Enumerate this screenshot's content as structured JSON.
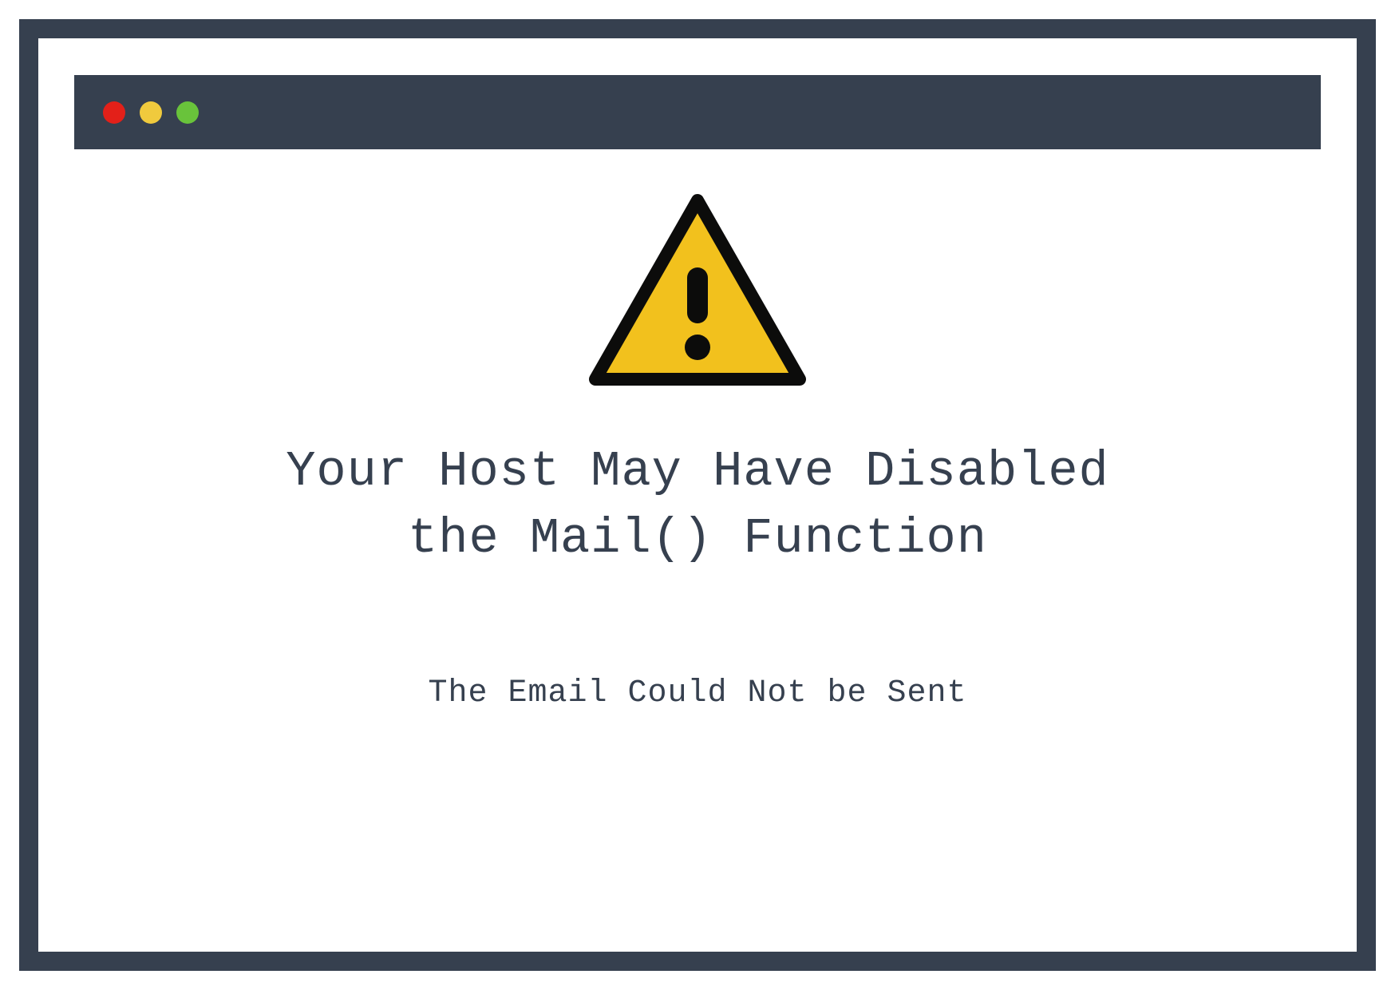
{
  "colors": {
    "frame": "#36404F",
    "dot_red": "#E32019",
    "dot_yellow": "#F0CA3D",
    "dot_green": "#69C33B",
    "warning_fill": "#F2C11D"
  },
  "icons": {
    "warning": "warning-triangle-icon",
    "close_dot": "close-dot-icon",
    "minimize_dot": "minimize-dot-icon",
    "maximize_dot": "maximize-dot-icon"
  },
  "message": {
    "heading_line1": "Your Host May Have Disabled",
    "heading_line2": "the Mail() Function",
    "subtext": "The Email Could Not be Sent"
  }
}
